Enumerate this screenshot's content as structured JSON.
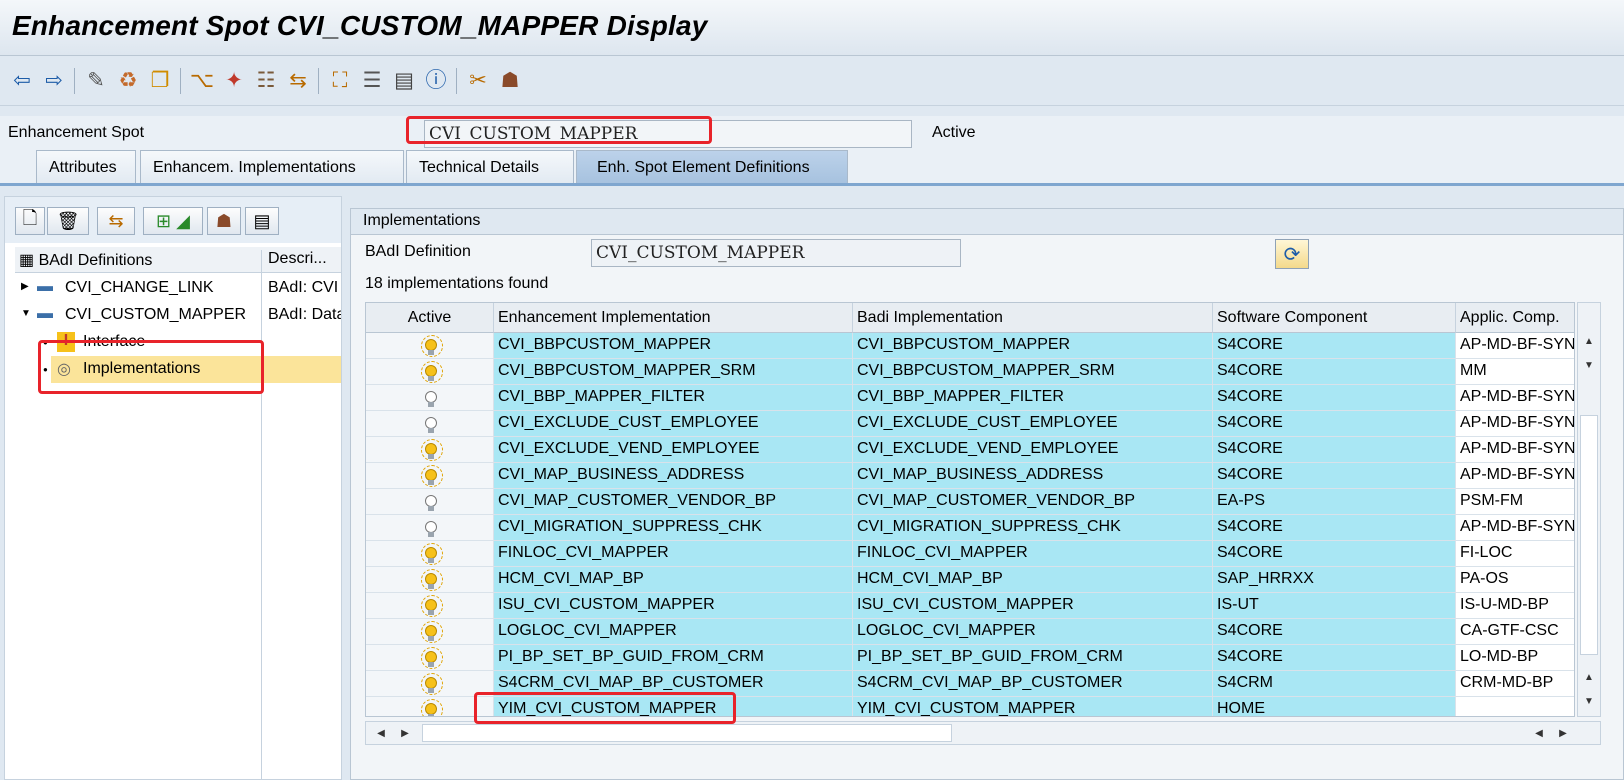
{
  "window": {
    "title": "Enhancement Spot CVI_CUSTOM_MAPPER Display"
  },
  "toolbar": {
    "icons": [
      "back-arrow-icon",
      "forward-arrow-icon",
      "display-change-icon",
      "other-object-icon",
      "copy-object-icon",
      "where-used-icon",
      "activate-icon",
      "test-icon",
      "enhance-icon",
      "hierarchy-icon",
      "navigator-icon",
      "display-object-list-icon",
      "info-icon",
      "enhancement-implementation-icon",
      "users-icon"
    ]
  },
  "header": {
    "spot_label": "Enhancement Spot",
    "spot_value": "CVI_CUSTOM_MAPPER",
    "status": "Active"
  },
  "tabs": [
    {
      "label": "Attributes"
    },
    {
      "label": "Enhancem. Implementations"
    },
    {
      "label": "Technical Details"
    },
    {
      "label": "Enh. Spot Element Definitions",
      "active": true
    }
  ],
  "tree": {
    "col_definitions": "BAdI Definitions",
    "col_description": "Descri...",
    "items": [
      {
        "label": "CVI_CHANGE_LINK",
        "desc": "BAdI: CVI",
        "level": 0,
        "expanded": false
      },
      {
        "label": "CVI_CUSTOM_MAPPER",
        "desc": "BAdI: Data",
        "level": 0,
        "expanded": true
      },
      {
        "label": "Interface",
        "desc": "",
        "level": 1
      },
      {
        "label": "Implementations",
        "desc": "",
        "level": 1,
        "selected": true
      }
    ]
  },
  "implementations": {
    "title": "Implementations",
    "badi_label": "BAdI Definition",
    "badi_value": "CVI_CUSTOM_MAPPER",
    "count_text": "18  implementations found",
    "columns": [
      "Active",
      "Enhancement Implementation",
      "Badi Implementation",
      "Software Component",
      "Applic. Comp."
    ],
    "rows": [
      {
        "active": true,
        "enh": "CVI_BBPCUSTOM_MAPPER",
        "badi": "CVI_BBPCUSTOM_MAPPER",
        "sw": "S4CORE",
        "app": "AP-MD-BF-SYN"
      },
      {
        "active": true,
        "enh": "CVI_BBPCUSTOM_MAPPER_SRM",
        "badi": "CVI_BBPCUSTOM_MAPPER_SRM",
        "sw": "S4CORE",
        "app": "MM"
      },
      {
        "active": false,
        "enh": "CVI_BBP_MAPPER_FILTER",
        "badi": "CVI_BBP_MAPPER_FILTER",
        "sw": "S4CORE",
        "app": "AP-MD-BF-SYN"
      },
      {
        "active": false,
        "enh": "CVI_EXCLUDE_CUST_EMPLOYEE",
        "badi": "CVI_EXCLUDE_CUST_EMPLOYEE",
        "sw": "S4CORE",
        "app": "AP-MD-BF-SYN"
      },
      {
        "active": true,
        "enh": "CVI_EXCLUDE_VEND_EMPLOYEE",
        "badi": "CVI_EXCLUDE_VEND_EMPLOYEE",
        "sw": "S4CORE",
        "app": "AP-MD-BF-SYN"
      },
      {
        "active": true,
        "enh": "CVI_MAP_BUSINESS_ADDRESS",
        "badi": "CVI_MAP_BUSINESS_ADDRESS",
        "sw": "S4CORE",
        "app": "AP-MD-BF-SYN"
      },
      {
        "active": false,
        "enh": "CVI_MAP_CUSTOMER_VENDOR_BP",
        "badi": "CVI_MAP_CUSTOMER_VENDOR_BP",
        "sw": "EA-PS",
        "app": "PSM-FM"
      },
      {
        "active": false,
        "enh": "CVI_MIGRATION_SUPPRESS_CHK",
        "badi": "CVI_MIGRATION_SUPPRESS_CHK",
        "sw": "S4CORE",
        "app": "AP-MD-BF-SYN"
      },
      {
        "active": true,
        "enh": "FINLOC_CVI_MAPPER",
        "badi": "FINLOC_CVI_MAPPER",
        "sw": "S4CORE",
        "app": "FI-LOC"
      },
      {
        "active": true,
        "enh": "HCM_CVI_MAP_BP",
        "badi": "HCM_CVI_MAP_BP",
        "sw": "SAP_HRRXX",
        "app": "PA-OS"
      },
      {
        "active": true,
        "enh": "ISU_CVI_CUSTOM_MAPPER",
        "badi": "ISU_CVI_CUSTOM_MAPPER",
        "sw": "IS-UT",
        "app": "IS-U-MD-BP"
      },
      {
        "active": true,
        "enh": "LOGLOC_CVI_MAPPER",
        "badi": "LOGLOC_CVI_MAPPER",
        "sw": "S4CORE",
        "app": "CA-GTF-CSC"
      },
      {
        "active": true,
        "enh": "PI_BP_SET_BP_GUID_FROM_CRM",
        "badi": "PI_BP_SET_BP_GUID_FROM_CRM",
        "sw": "S4CORE",
        "app": "LO-MD-BP"
      },
      {
        "active": true,
        "enh": "S4CRM_CVI_MAP_BP_CUSTOMER",
        "badi": "S4CRM_CVI_MAP_BP_CUSTOMER",
        "sw": "S4CRM",
        "app": "CRM-MD-BP"
      },
      {
        "active": true,
        "enh": "YIM_CVI_CUSTOM_MAPPER",
        "badi": "YIM_CVI_CUSTOM_MAPPER",
        "sw": "HOME",
        "app": ""
      }
    ]
  },
  "colors": {
    "row_highlight": "#a9e7f4",
    "selection": "#fbe49a",
    "annotation": "#e8232a"
  }
}
